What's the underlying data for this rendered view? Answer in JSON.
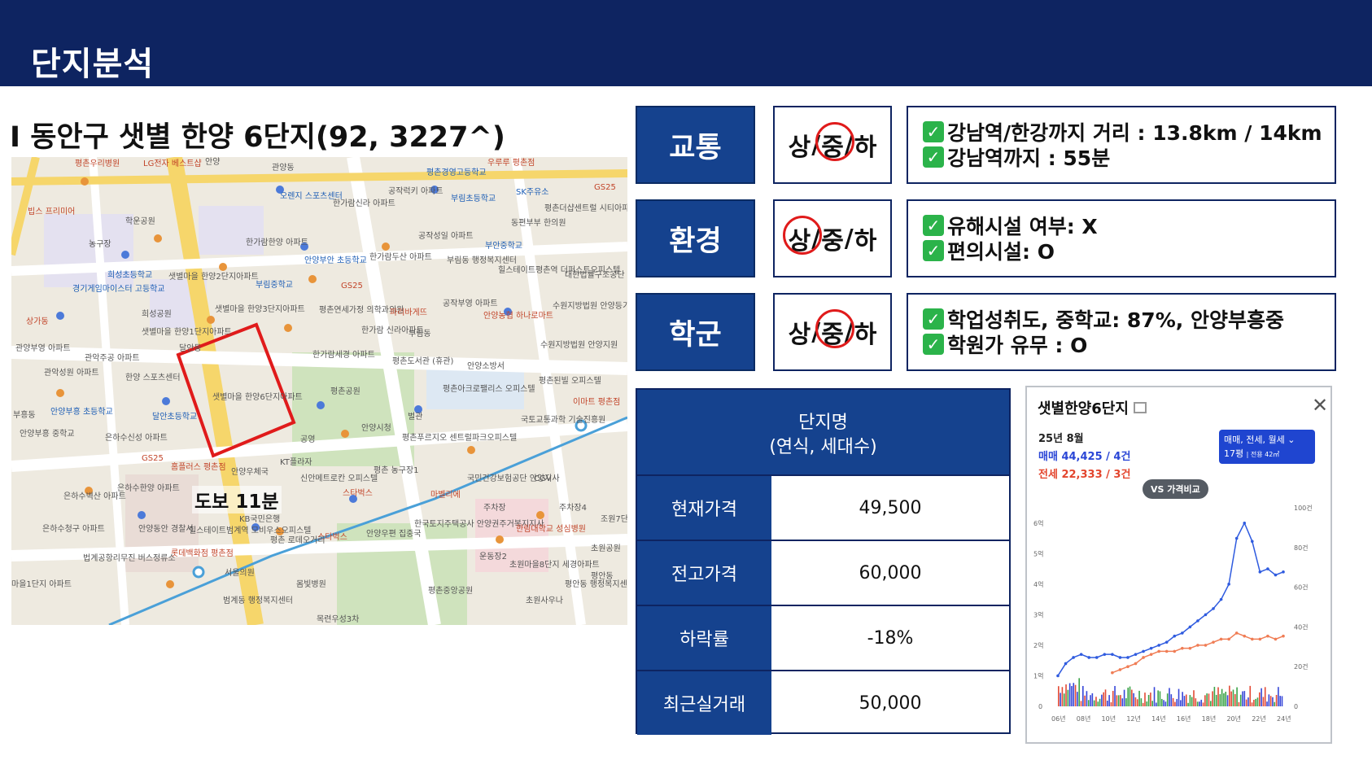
{
  "header": {
    "title": "단지분석"
  },
  "subtitle": "I 동안구 샛별 한양 6단지(92, 3227^)",
  "map": {
    "walk_label": "도보 11분",
    "labels": [
      "평촌우리병원",
      "LG전자 베스트샵",
      "안양",
      "관양동",
      "평촌경영고등학교",
      "우루루 평촌점",
      "오렌지 스포츠센터",
      "한가람신라 아파트",
      "공작럭키 아파트",
      "부림초등학교",
      "SK주유소",
      "GS25",
      "평촌더샵센트럴 시티아파트",
      "빕스 프리미어",
      "학운공원",
      "동편부부 한의원",
      "농구장",
      "한가람한양 아파트",
      "공작성일 아파트",
      "부안중학교",
      "희성초등학교",
      "샛별마을 한양2단지아파트",
      "안양부안 초등학교",
      "한가람두산 아파트",
      "부림동 행정복지센터",
      "힐스테이트평촌역 더퍼스트오피스텔",
      "대한법률구조공단 안양출장소",
      "경기게임마이스터 고등학교",
      "부림중학교",
      "GS25",
      "희성공원",
      "샛별마을 한양3단지아파트",
      "평촌연세가정 의학과의원",
      "파리바게뜨",
      "공작부영 아파트",
      "수원지방법원 안양등기소",
      "상가동",
      "샛별마을 한양1단지아파트",
      "한가람 신라아파트",
      "부림동",
      "안양농협 하나로마트",
      "관양부영 아파트",
      "관악주공 아파트",
      "달안동",
      "한가람세경 아파트",
      "평촌도서관 (휴관)",
      "수원지방법원 안양지원",
      "관악성원 아파트",
      "한양 스포츠센터",
      "샛별마을 한양6단지아파트",
      "평촌공원",
      "안양소방서",
      "평촌아크로팰리스 오피스텔",
      "평촌된빌 오피스텔",
      "부흥동",
      "안양부흥 초등학교",
      "달안초등학교",
      "벌관",
      "국토교통과학 기술진흥원",
      "이마트 평촌점",
      "안양부흥 중학교",
      "은하수신성 아파트",
      "GS25",
      "공영",
      "안양시청",
      "평촌푸르지오 센트럴파크오피스텔",
      "홈플러스 평촌점",
      "KT플라자",
      "신안메트로칸 오피스텔",
      "안양우체국",
      "평촌 농구장1",
      "CGV",
      "국민건강보험공단 안양지사",
      "은하수벽산 아파트",
      "은하수한양 아파트",
      "스타벅스",
      "마벨리에",
      "주차장",
      "주차장4",
      "조원7단 부영아파트",
      "은하수청구 아파트",
      "안양동안 경찰서",
      "KB국민은행",
      "힐스테이트범계역 모비우스오피스텔",
      "평촌 로데오거리",
      "스타벅스",
      "안양우편 집중국",
      "한국토지주택공사 안양권주거복지지사",
      "한림대학교 성심병원",
      "초원공원",
      "법계공항리무진 버스정류소",
      "롯데백화점 평촌점",
      "서울의원",
      "운동장2",
      "초원마을8단지 세경아파트",
      "평안동",
      "마을1단지 아파트",
      "범계동 행정복지센터",
      "몸빛병원",
      "평촌중앙공원",
      "초원사우나",
      "평안동 행정복지센터",
      "목련우성3차"
    ]
  },
  "ratings": [
    {
      "category": "교통",
      "grades": [
        "상",
        "중",
        "하"
      ],
      "selected": "중",
      "lines": [
        "강남역/한강까지 거리 : 13.8km / 14km",
        "강남역까지 : 55분"
      ]
    },
    {
      "category": "환경",
      "grades": [
        "상",
        "중",
        "하"
      ],
      "selected": "상",
      "lines": [
        "유해시설 여부: X",
        "편의시설: O"
      ]
    },
    {
      "category": "학군",
      "grades": [
        "상",
        "중",
        "하"
      ],
      "selected": "중",
      "lines": [
        "학업성취도, 중학교: 87%, 안양부흥중",
        "학원가 유무 : O"
      ]
    }
  ],
  "price_table": {
    "header_line1": "단지명",
    "header_line2": "(연식, 세대수)",
    "rows": [
      {
        "label": "현재가격",
        "value": "49,500"
      },
      {
        "label": "전고가격",
        "value": "60,000"
      },
      {
        "label": "하락률",
        "value": "-18%"
      },
      {
        "label": "최근실거래",
        "value": "50,000"
      }
    ]
  },
  "chart_card": {
    "title": "샛별한양6단지",
    "date": "25년 8월",
    "sale": "매매 44,425 / 4건",
    "jeonse": "전세 22,333 / 3건",
    "filter_line1": "매매, 전세, 월세 ⌄",
    "filter_line2": "17평",
    "filter_line2_small": "| 전용 42㎡",
    "vs_button": "VS 가격비교",
    "close": "✕"
  },
  "chart_data": {
    "type": "line",
    "x": [
      "06년",
      "08년",
      "10년",
      "12년",
      "14년",
      "16년",
      "18년",
      "20년",
      "22년",
      "24년"
    ],
    "y_left_ticks": [
      "1억",
      "2억",
      "3억",
      "4억",
      "5억",
      "6억"
    ],
    "y_right_ticks": [
      "0",
      "20건",
      "40건",
      "60건",
      "80건",
      "100건"
    ],
    "y_left_range_eok": [
      0,
      6.5
    ],
    "y_right_range_count": [
      0,
      100
    ],
    "legend": "none",
    "grid": false,
    "series": [
      {
        "name": "매매",
        "color": "#2f5bdf",
        "values": [
          1.0,
          1.4,
          1.6,
          1.7,
          1.6,
          1.6,
          1.7,
          1.7,
          1.6,
          1.6,
          1.7,
          1.8,
          1.9,
          2.0,
          2.1,
          2.3,
          2.4,
          2.6,
          2.8,
          3.0,
          3.2,
          3.5,
          4.0,
          5.5,
          6.0,
          5.4,
          4.4,
          4.5,
          4.3,
          4.4
        ]
      },
      {
        "name": "전세",
        "color": "#f07d55",
        "values": [
          null,
          null,
          null,
          null,
          null,
          null,
          null,
          1.1,
          1.2,
          1.3,
          1.4,
          1.6,
          1.7,
          1.8,
          1.8,
          1.8,
          1.9,
          1.9,
          2.0,
          2.0,
          2.1,
          2.2,
          2.2,
          2.4,
          2.3,
          2.2,
          2.2,
          2.3,
          2.2,
          2.3
        ]
      }
    ],
    "volume_colors": [
      "#3646d8",
      "#e34a35",
      "#3aa347"
    ]
  }
}
